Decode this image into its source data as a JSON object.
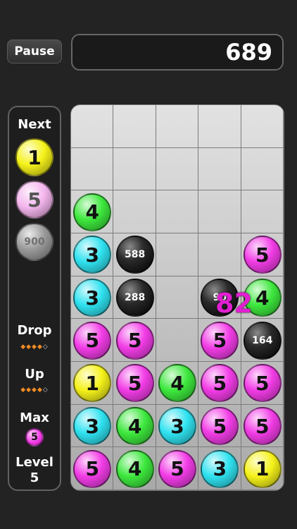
{
  "header": {
    "pause_label": "Pause",
    "score": "689"
  },
  "sidebar": {
    "next_label": "Next",
    "next_balls": [
      {
        "value": "1",
        "color": "#f5f21a"
      },
      {
        "value": "5",
        "color": "#f4b6ee"
      },
      {
        "value": "900",
        "color": "#9a9a9a"
      }
    ],
    "drop_label": "Drop",
    "drop_dots": [
      true,
      true,
      true,
      true,
      false
    ],
    "up_label": "Up",
    "up_dots": [
      true,
      true,
      true,
      true,
      false
    ],
    "max_label": "Max",
    "max_value": "5",
    "level_label": "Level",
    "level_value": "5"
  },
  "board": {
    "columns": 5,
    "rows": 9,
    "pieces": [
      {
        "row": 2,
        "col": 0,
        "value": "4",
        "color": "#3de83d",
        "type": "number"
      },
      {
        "row": 3,
        "col": 0,
        "value": "3",
        "color": "#2fe2f0",
        "type": "number"
      },
      {
        "row": 3,
        "col": 1,
        "value": "588",
        "color": "#1a1a1a",
        "type": "block"
      },
      {
        "row": 3,
        "col": 4,
        "value": "5",
        "color": "#f23ce6",
        "type": "number"
      },
      {
        "row": 4,
        "col": 0,
        "value": "3",
        "color": "#2fe2f0",
        "type": "number"
      },
      {
        "row": 4,
        "col": 1,
        "value": "288",
        "color": "#1a1a1a",
        "type": "block"
      },
      {
        "row": 4,
        "col": 3,
        "value": "90",
        "color": "#1a1a1a",
        "type": "block"
      },
      {
        "row": 4,
        "col": 4,
        "value": "4",
        "color": "#3de83d",
        "type": "number"
      },
      {
        "row": 5,
        "col": 0,
        "value": "5",
        "color": "#f23ce6",
        "type": "number"
      },
      {
        "row": 5,
        "col": 1,
        "value": "5",
        "color": "#f23ce6",
        "type": "number"
      },
      {
        "row": 5,
        "col": 3,
        "value": "5",
        "color": "#f23ce6",
        "type": "number"
      },
      {
        "row": 5,
        "col": 4,
        "value": "164",
        "color": "#1a1a1a",
        "type": "block"
      },
      {
        "row": 6,
        "col": 0,
        "value": "1",
        "color": "#f5f21a",
        "type": "number"
      },
      {
        "row": 6,
        "col": 1,
        "value": "5",
        "color": "#f23ce6",
        "type": "number"
      },
      {
        "row": 6,
        "col": 2,
        "value": "4",
        "color": "#3de83d",
        "type": "number"
      },
      {
        "row": 6,
        "col": 3,
        "value": "5",
        "color": "#f23ce6",
        "type": "number"
      },
      {
        "row": 6,
        "col": 4,
        "value": "5",
        "color": "#f23ce6",
        "type": "number"
      },
      {
        "row": 7,
        "col": 0,
        "value": "3",
        "color": "#2fe2f0",
        "type": "number"
      },
      {
        "row": 7,
        "col": 1,
        "value": "4",
        "color": "#3de83d",
        "type": "number"
      },
      {
        "row": 7,
        "col": 2,
        "value": "3",
        "color": "#2fe2f0",
        "type": "number"
      },
      {
        "row": 7,
        "col": 3,
        "value": "5",
        "color": "#f23ce6",
        "type": "number"
      },
      {
        "row": 7,
        "col": 4,
        "value": "5",
        "color": "#f23ce6",
        "type": "number"
      },
      {
        "row": 8,
        "col": 0,
        "value": "5",
        "color": "#f23ce6",
        "type": "number"
      },
      {
        "row": 8,
        "col": 1,
        "value": "4",
        "color": "#3de83d",
        "type": "number"
      },
      {
        "row": 8,
        "col": 2,
        "value": "5",
        "color": "#f23ce6",
        "type": "number"
      },
      {
        "row": 8,
        "col": 3,
        "value": "3",
        "color": "#2fe2f0",
        "type": "number"
      },
      {
        "row": 8,
        "col": 4,
        "value": "1",
        "color": "#f5f21a",
        "type": "number"
      }
    ],
    "floating_score": "82"
  }
}
